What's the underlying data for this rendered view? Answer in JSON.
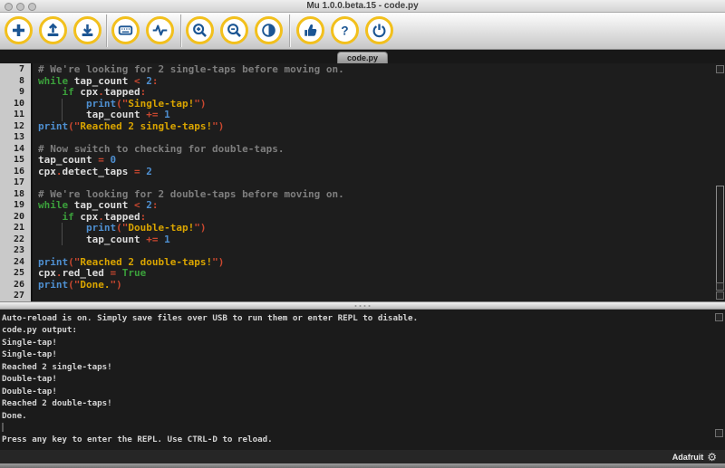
{
  "window": {
    "title": "Mu 1.0.0.beta.15 - code.py"
  },
  "colors": {
    "toolbar_ring_yellow": "#f2c01d",
    "toolbar_icon_blue": "#1b5593",
    "keyword_green": "#3ba03b",
    "operator_red": "#c9472f",
    "number_blue": "#4e8fd0",
    "string_yellow": "#d9a400",
    "comment_gray": "#7e7e7e"
  },
  "toolbar": {
    "buttons": [
      {
        "id": "new",
        "icon": "plus"
      },
      {
        "id": "load",
        "icon": "upload"
      },
      {
        "id": "save",
        "icon": "download"
      },
      {
        "id": "serial",
        "icon": "keyboard"
      },
      {
        "id": "plotter",
        "icon": "waveform"
      },
      {
        "id": "zoom-in",
        "icon": "magnifier-plus"
      },
      {
        "id": "zoom-out",
        "icon": "magnifier-minus"
      },
      {
        "id": "theme",
        "icon": "contrast"
      },
      {
        "id": "check",
        "icon": "thumbs-up"
      },
      {
        "id": "help",
        "icon": "question-mark"
      },
      {
        "id": "quit",
        "icon": "power"
      }
    ]
  },
  "tab": {
    "label": "code.py"
  },
  "editor": {
    "lines": [
      {
        "n": 7,
        "t": [
          [
            "com",
            "# We're looking for 2 single-taps before moving on."
          ]
        ]
      },
      {
        "n": 8,
        "t": [
          [
            "kw",
            "while"
          ],
          [
            "id",
            " tap_count "
          ],
          [
            "op",
            "< "
          ],
          [
            "num",
            "2"
          ],
          [
            "op",
            ":"
          ]
        ]
      },
      {
        "n": 9,
        "t": [
          [
            "id",
            "    "
          ],
          [
            "kw",
            "if"
          ],
          [
            "id",
            " cpx"
          ],
          [
            "op",
            "."
          ],
          [
            "id",
            "tapped"
          ],
          [
            "op",
            ":"
          ]
        ]
      },
      {
        "n": 10,
        "guide": true,
        "t": [
          [
            "id",
            "        "
          ],
          [
            "fn",
            "print"
          ],
          [
            "op",
            "("
          ],
          [
            "qt",
            "\""
          ],
          [
            "str",
            "Single-tap!"
          ],
          [
            "qt",
            "\""
          ],
          [
            "op",
            ")"
          ]
        ]
      },
      {
        "n": 11,
        "guide": true,
        "t": [
          [
            "id",
            "        tap_count "
          ],
          [
            "op",
            "+= "
          ],
          [
            "num",
            "1"
          ]
        ]
      },
      {
        "n": 12,
        "t": [
          [
            "fn",
            "print"
          ],
          [
            "op",
            "("
          ],
          [
            "qt",
            "\""
          ],
          [
            "str",
            "Reached 2 single-taps!"
          ],
          [
            "qt",
            "\""
          ],
          [
            "op",
            ")"
          ]
        ]
      },
      {
        "n": 13,
        "t": []
      },
      {
        "n": 14,
        "t": [
          [
            "com",
            "# Now switch to checking for double-taps."
          ]
        ]
      },
      {
        "n": 15,
        "t": [
          [
            "id",
            "tap_count "
          ],
          [
            "op",
            "= "
          ],
          [
            "num",
            "0"
          ]
        ]
      },
      {
        "n": 16,
        "t": [
          [
            "id",
            "cpx"
          ],
          [
            "op",
            "."
          ],
          [
            "id",
            "detect_taps "
          ],
          [
            "op",
            "= "
          ],
          [
            "num",
            "2"
          ]
        ]
      },
      {
        "n": 17,
        "t": []
      },
      {
        "n": 18,
        "t": [
          [
            "com",
            "# We're looking for 2 double-taps before moving on."
          ]
        ]
      },
      {
        "n": 19,
        "t": [
          [
            "kw",
            "while"
          ],
          [
            "id",
            " tap_count "
          ],
          [
            "op",
            "< "
          ],
          [
            "num",
            "2"
          ],
          [
            "op",
            ":"
          ]
        ]
      },
      {
        "n": 20,
        "t": [
          [
            "id",
            "    "
          ],
          [
            "kw",
            "if"
          ],
          [
            "id",
            " cpx"
          ],
          [
            "op",
            "."
          ],
          [
            "id",
            "tapped"
          ],
          [
            "op",
            ":"
          ]
        ]
      },
      {
        "n": 21,
        "guide": true,
        "t": [
          [
            "id",
            "        "
          ],
          [
            "fn",
            "print"
          ],
          [
            "op",
            "("
          ],
          [
            "qt",
            "\""
          ],
          [
            "str",
            "Double-tap!"
          ],
          [
            "qt",
            "\""
          ],
          [
            "op",
            ")"
          ]
        ]
      },
      {
        "n": 22,
        "guide": true,
        "t": [
          [
            "id",
            "        tap_count "
          ],
          [
            "op",
            "+= "
          ],
          [
            "num",
            "1"
          ]
        ]
      },
      {
        "n": 23,
        "t": []
      },
      {
        "n": 24,
        "t": [
          [
            "fn",
            "print"
          ],
          [
            "op",
            "("
          ],
          [
            "qt",
            "\""
          ],
          [
            "str",
            "Reached 2 double-taps!"
          ],
          [
            "qt",
            "\""
          ],
          [
            "op",
            ")"
          ]
        ]
      },
      {
        "n": 25,
        "t": [
          [
            "id",
            "cpx"
          ],
          [
            "op",
            "."
          ],
          [
            "id",
            "red_led "
          ],
          [
            "op",
            "= "
          ],
          [
            "kw",
            "True"
          ]
        ]
      },
      {
        "n": 26,
        "t": [
          [
            "fn",
            "print"
          ],
          [
            "op",
            "("
          ],
          [
            "qt",
            "\""
          ],
          [
            "str",
            "Done."
          ],
          [
            "qt",
            "\""
          ],
          [
            "op",
            ")"
          ]
        ]
      },
      {
        "n": 27,
        "t": []
      }
    ]
  },
  "repl": {
    "lines": [
      "Auto-reload is on. Simply save files over USB to run them or enter REPL to disable.",
      "code.py output:",
      "Single-tap!",
      "Single-tap!",
      "Reached 2 single-taps!",
      "Double-tap!",
      "Double-tap!",
      "Reached 2 double-taps!",
      "Done.",
      "",
      "Press any key to enter the REPL. Use CTRL-D to reload."
    ],
    "cursor_line": 9
  },
  "statusbar": {
    "brand": "Adafruit"
  },
  "icons": {
    "gear": "⚙"
  }
}
